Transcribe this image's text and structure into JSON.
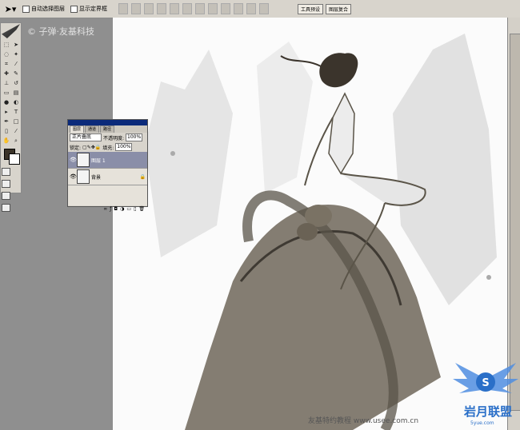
{
  "options_bar": {
    "tool_icon": "move-arrow-icon",
    "auto_select_label": "自动选择图层",
    "show_transform_label": "显示定界框",
    "palette_tabs": [
      "工具预设",
      "图层复合"
    ]
  },
  "watermark": "© 子弹·友基科技",
  "toolbox": {
    "icons": [
      "marquee",
      "move",
      "lasso",
      "wand",
      "crop",
      "slice",
      "heal",
      "brush",
      "stamp",
      "history",
      "eraser",
      "gradient",
      "blur",
      "dodge",
      "path",
      "type",
      "pen",
      "shape",
      "notes",
      "eyedropper",
      "hand",
      "zoom"
    ]
  },
  "layers_panel": {
    "tabs": [
      "图层",
      "通道",
      "路径"
    ],
    "blend_mode": "正片叠底",
    "opacity_label": "不透明度:",
    "opacity_value": "100%",
    "lock_label": "锁定:",
    "fill_label": "填充:",
    "fill_value": "100%",
    "layers": [
      {
        "name": "图层 1",
        "selected": true
      },
      {
        "name": "背景",
        "selected": false
      }
    ]
  },
  "caption": "友基特约教程 www.usee.com.cn",
  "logo": {
    "text": "岩月联盟",
    "url": "5yue.com",
    "badge": "S"
  },
  "colors": {
    "panel_titlebar": "#0b2a7a",
    "foreground": "#3a3228",
    "background": "#ffffff"
  }
}
